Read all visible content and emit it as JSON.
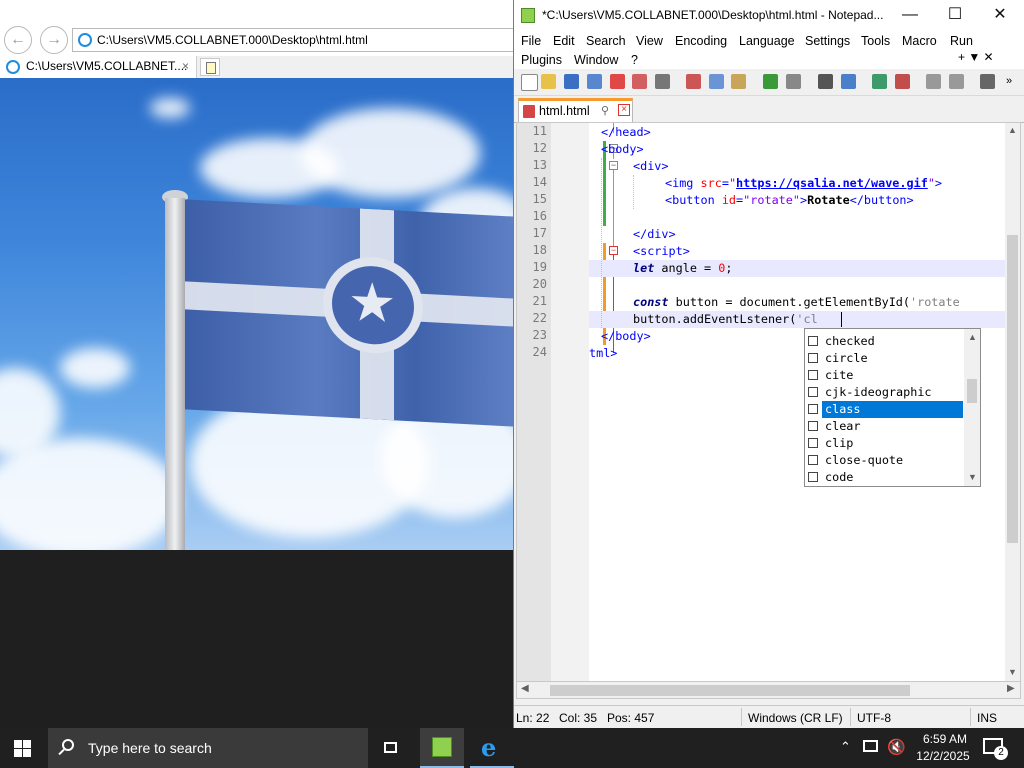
{
  "ie": {
    "address": "C:\\Users\\VM5.COLLABNET.000\\Desktop\\html.html",
    "tab_title": "C:\\Users\\VM5.COLLABNET....",
    "tab_close": "×"
  },
  "npp": {
    "title": "*C:\\Users\\VM5.COLLABNET.000\\Desktop\\html.html - Notepad...",
    "window_controls": {
      "minimize": "—",
      "maximize": "☐",
      "close": "✕"
    },
    "menu": [
      "File",
      "Edit",
      "Search",
      "View",
      "Encoding",
      "Language",
      "Settings",
      "Tools",
      "Macro",
      "Run",
      "Plugins",
      "Window",
      "?"
    ],
    "menu_extra": "+  ▼  ✕",
    "tab": {
      "label": "html.html"
    },
    "line_numbers": [
      "11",
      "12",
      "13",
      "14",
      "15",
      "16",
      "17",
      "18",
      "19",
      "20",
      "21",
      "22",
      "23",
      "24"
    ],
    "code": {
      "l11": "</head>",
      "l12": "<body>",
      "l13": "<div>",
      "l14_tag": "<img ",
      "l14_attr": "src",
      "l14_eq": "=",
      "l14_q1": "\"",
      "l14_url": "https://qsalia.net/wave.gif",
      "l14_q2": "\"",
      "l14_end": ">",
      "l15_tag": "<button ",
      "l15_attr": "id",
      "l15_eq": "=",
      "l15_val": "\"rotate\"",
      "l15_gt": ">",
      "l15_text": "Rotate",
      "l15_close": "</button>",
      "l17": "</div>",
      "l18": "<script>",
      "l19_kw": "let",
      "l19_mid": " angle = ",
      "l19_num": "0",
      "l19_end": ";",
      "l21_kw": "const",
      "l21_mid": " button = document.getElementById(",
      "l21_str": "'rotate",
      "l22_a": "button.addEventLstener(",
      "l22_str": "'cl",
      "l23": "</body>",
      "l24": "tml>"
    },
    "autocomplete": [
      "checked",
      "circle",
      "cite",
      "cjk-ideographic",
      "class",
      "clear",
      "clip",
      "close-quote",
      "code"
    ],
    "autocomplete_selected": "class",
    "status": {
      "ln": "Ln: 22",
      "col": "Col: 35",
      "pos": "Pos: 457",
      "eol": "Windows (CR LF)",
      "encoding": "UTF-8",
      "mode": "INS"
    }
  },
  "taskbar": {
    "search_placeholder": "Type here to search",
    "time": "6:59 AM",
    "date": "12/2/2025",
    "notifications": "2"
  },
  "colors": {
    "selection": "#0078d7",
    "tab_accent": "#f79a2e",
    "taskbar": "#202020"
  }
}
